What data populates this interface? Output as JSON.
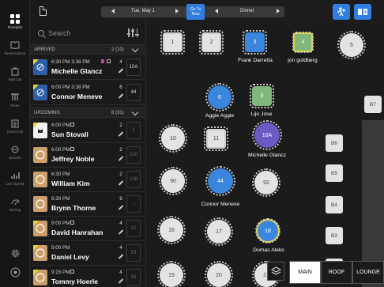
{
  "rail": [
    {
      "label": "Floorplan",
      "icon": "floorplan-icon",
      "active": true
    },
    {
      "label": "Reservations",
      "icon": "book-icon",
      "active": false
    },
    {
      "label": "Wait List",
      "icon": "waitlist-icon",
      "active": false
    },
    {
      "label": "Pines",
      "icon": "pines-icon",
      "active": false
    },
    {
      "label": "Guest List",
      "icon": "guestlist-icon",
      "active": false
    },
    {
      "label": "Servers",
      "icon": "servers-icon",
      "active": false
    },
    {
      "label": "Live Spend",
      "icon": "livespend-icon",
      "active": false
    },
    {
      "label": "Shrimp",
      "icon": "shrimp-icon",
      "active": false
    }
  ],
  "search": {
    "placeholder": "Search"
  },
  "arrived": {
    "label": "ARRIVED",
    "count": "2 (10)"
  },
  "upcoming": {
    "label": "UPCOMING",
    "count": "8 (31)"
  },
  "arrived_list": [
    {
      "time": "6:30 PM 3:38 PM",
      "name": "Michelle Glancz",
      "party": "4",
      "table": "10A",
      "tag": "#d63a9b"
    },
    {
      "time": "6:00 PM 3:38 PM",
      "name": "Connor Meneve",
      "party": "6",
      "table": "44",
      "tag": ""
    }
  ],
  "upcoming_list": [
    {
      "time": "6:00 PM",
      "name": "Sun Stovall",
      "party": "2",
      "table": "1"
    },
    {
      "time": "6:00 PM",
      "name": "Jeffrey Noble",
      "party": "2",
      "table": "100"
    },
    {
      "time": "6:30 PM",
      "name": "William Kim",
      "party": "2",
      "table": "108"
    },
    {
      "time": "8:30 PM",
      "name": "Brynn Thorne",
      "party": "9",
      "table": "..."
    },
    {
      "time": "9:00 PM",
      "name": "David Hanrahan",
      "party": "4",
      "table": "12"
    },
    {
      "time": "9:00 PM",
      "name": "Daniel Levy",
      "party": "4",
      "table": "53"
    },
    {
      "time": "9:15 PM",
      "name": "Tommy Hoerle",
      "party": "4",
      "table": "58"
    }
  ],
  "topbar": {
    "date": "Tue, May 1",
    "go_today": "Go To Now",
    "shift": "Dinner"
  },
  "tables": [
    {
      "num": "1",
      "shape": "sq",
      "style": "plain"
    },
    {
      "num": "2",
      "shape": "sq",
      "style": "plain"
    },
    {
      "num": "3",
      "shape": "sq",
      "style": "blue",
      "guest": "Frank Darretta"
    },
    {
      "num": "4",
      "shape": "sq",
      "style": "green",
      "guest": "jon goldberg"
    },
    {
      "num": "5",
      "shape": "round",
      "style": "plain"
    },
    {
      "num": "6",
      "shape": "round",
      "style": "blue",
      "guest": "Aggie Aggie"
    },
    {
      "num": "9",
      "shape": "sq",
      "style": "green",
      "guest": "Lijo Jose"
    },
    {
      "num": "10A",
      "shape": "round",
      "style": "purple",
      "guest": "Michelle Glancz"
    },
    {
      "num": "10",
      "shape": "round",
      "style": "plain"
    },
    {
      "num": "11",
      "shape": "sq",
      "style": "plain"
    },
    {
      "num": "90",
      "shape": "round",
      "style": "plain"
    },
    {
      "num": "44",
      "shape": "round",
      "style": "blue",
      "guest": "Connor Meneve"
    },
    {
      "num": "92",
      "shape": "round",
      "style": "plain"
    },
    {
      "num": "16",
      "shape": "round",
      "style": "plain"
    },
    {
      "num": "17",
      "shape": "round",
      "style": "plain"
    },
    {
      "num": "18",
      "shape": "round",
      "style": "blue",
      "guest": "Dumas Aleks"
    },
    {
      "num": "19",
      "shape": "round",
      "style": "plain"
    },
    {
      "num": "20",
      "shape": "round",
      "style": "plain"
    },
    {
      "num": "21",
      "shape": "round",
      "style": "plain"
    }
  ],
  "booths": [
    "B7",
    "B6",
    "B5",
    "B4",
    "B3",
    "B2"
  ],
  "rooms": [
    "MAIN",
    "ROOF",
    "LOUNGE"
  ],
  "colors": {
    "accent": "#2f7ee0",
    "seated_blue": "#3a86dc",
    "seated_green": "#7fb87a",
    "seated_purple": "#6a5bc4",
    "tag_yellow": "#e8d23a",
    "tag_magenta": "#d63a9b"
  }
}
